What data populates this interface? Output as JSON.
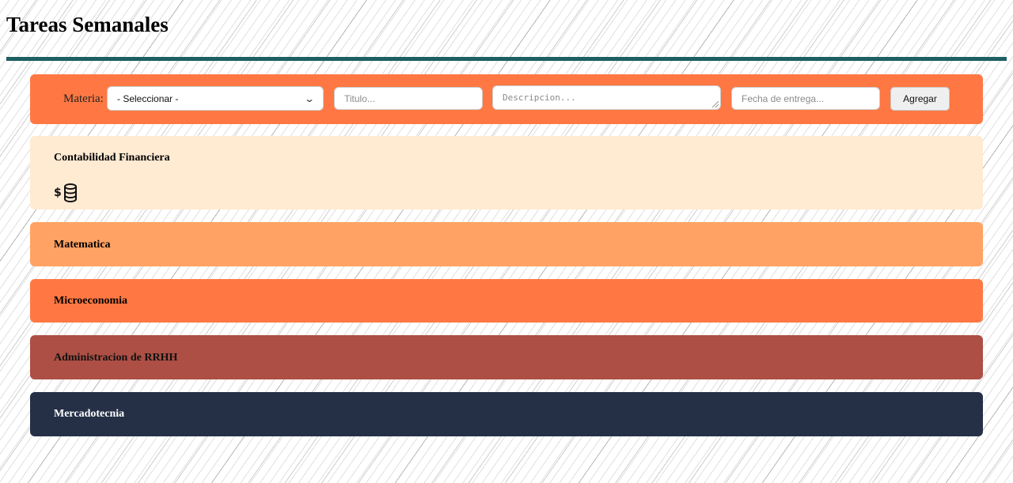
{
  "page": {
    "title": "Tareas Semanales"
  },
  "form": {
    "materia_label": "Materia:",
    "materia_select_value": "- Seleccionar -",
    "titulo_placeholder": "Titulo...",
    "descripcion_placeholder": "Descripcion...",
    "fecha_placeholder": "Fecha de entrega...",
    "add_button_label": "Agregar"
  },
  "subjects": [
    {
      "name": "Contabilidad Financiera",
      "bg": "#ffead2",
      "text_color": "#000000",
      "icon": "coins-dollar-icon"
    },
    {
      "name": "Matematica",
      "bg": "#ffa263",
      "text_color": "#000000"
    },
    {
      "name": "Microeconomia",
      "bg": "#ff7843",
      "text_color": "#000000"
    },
    {
      "name": "Administracion de RRHH",
      "bg": "#ad4f44",
      "text_color": "#111111"
    },
    {
      "name": "Mercadotecnia",
      "bg": "#253047",
      "text_color": "#ffffff"
    }
  ],
  "colors": {
    "accent_rule": "#1e5f63",
    "form_bar": "#ff7843"
  }
}
